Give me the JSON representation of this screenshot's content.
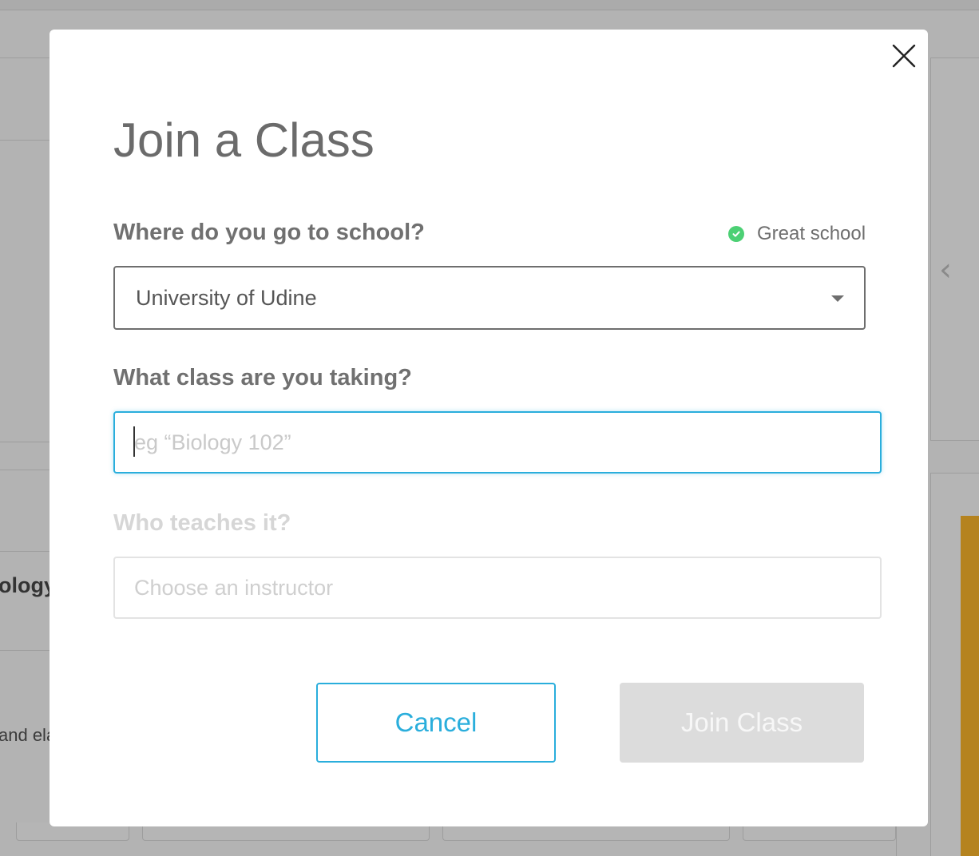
{
  "modal": {
    "title": "Join a Class",
    "close_icon": "close-icon",
    "school": {
      "label": "Where do you go to school?",
      "status_text": "Great school",
      "status_icon": "check-circle-icon",
      "status_color": "#4cd074",
      "selected_value": "University of Udine"
    },
    "class": {
      "label": "What class are you taking?",
      "value": "",
      "placeholder": "eg “Biology 102”"
    },
    "teacher": {
      "label": "Who teaches it?",
      "value": "",
      "placeholder": "Choose an instructor"
    },
    "buttons": {
      "cancel_label": "Cancel",
      "join_label": "Join Class"
    },
    "colors": {
      "accent": "#2aaedc",
      "disabled_button": "#dcdcdc"
    }
  },
  "background": {
    "partial_text_1": "ology",
    "partial_text_2": "and ela",
    "chevron_icon": "chevron-left-icon"
  }
}
